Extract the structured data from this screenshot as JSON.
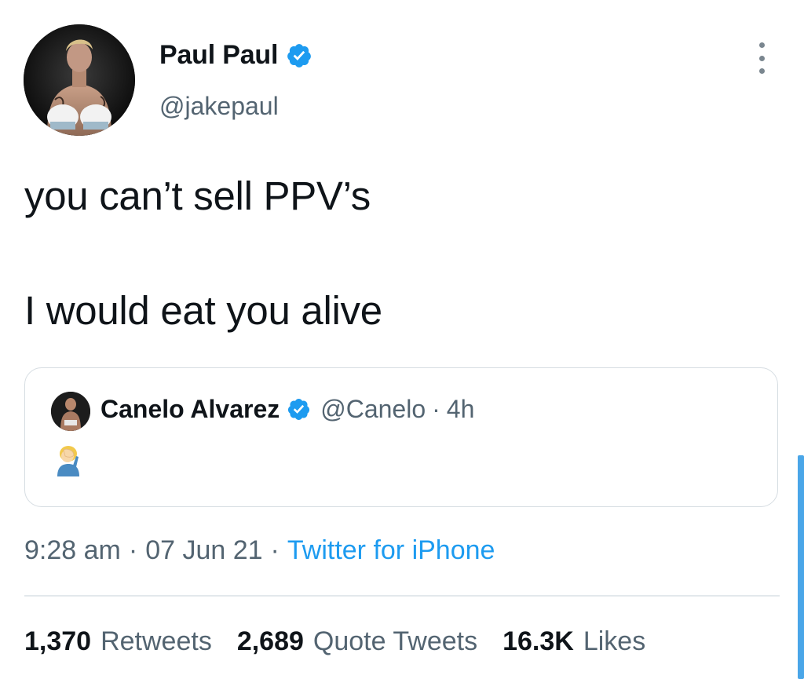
{
  "author": {
    "display_name": "Paul Paul",
    "handle": "@jakepaul",
    "verified": true,
    "avatar_icon": "boxer-avatar"
  },
  "tweet": {
    "lines": [
      "you can’t sell PPV’s",
      "I would eat you alive"
    ]
  },
  "quoted_tweet": {
    "display_name": "Canelo Alvarez",
    "handle": "@Canelo",
    "separator": "·",
    "time": "4h",
    "verified": true,
    "content_icon": "face-palm-emoji"
  },
  "meta": {
    "time": "9:28 am",
    "dot": "·",
    "date": "07 Jun 21",
    "source": "Twitter for iPhone"
  },
  "stats": {
    "retweets_count": "1,370",
    "retweets_label": "Retweets",
    "quotes_count": "2,689",
    "quotes_label": "Quote Tweets",
    "likes_count": "16.3K",
    "likes_label": "Likes"
  },
  "colors": {
    "accent": "#1d9bf0",
    "text_primary": "#0f1419",
    "text_secondary": "#536471",
    "border": "#d6dde2"
  }
}
